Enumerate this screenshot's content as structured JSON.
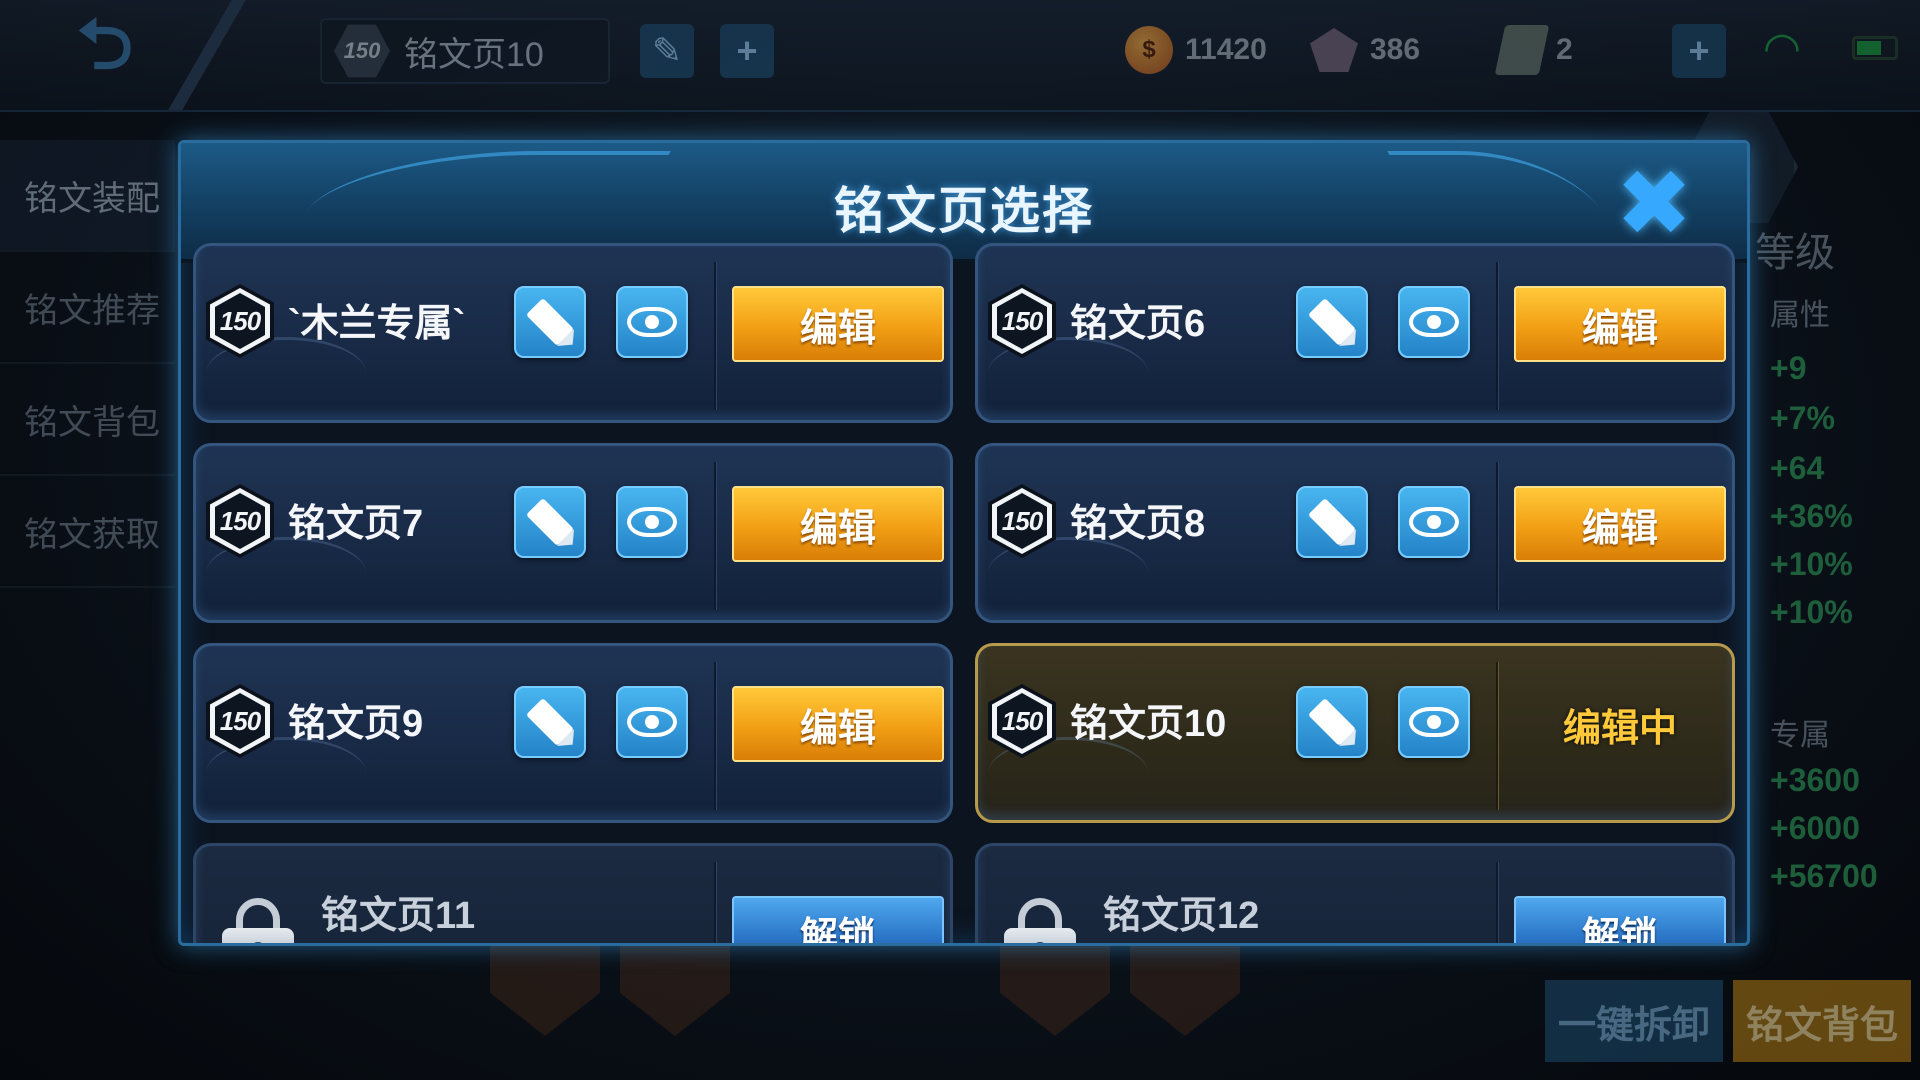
{
  "topbar": {
    "back_icon": "back-arrow-icon",
    "current_page_level": "150",
    "current_page_name": "铭文页10",
    "currency": {
      "gold": "11420",
      "diamonds": "386",
      "tickets": "2"
    }
  },
  "leftnav": {
    "items": [
      {
        "label": "铭文装配"
      },
      {
        "label": "铭文推荐"
      },
      {
        "label": "铭文背包"
      },
      {
        "label": "铭文获取"
      }
    ]
  },
  "right_panel": {
    "level_label": "等级",
    "attr_label": "属性",
    "stats": [
      "+9",
      "+7%",
      "+64",
      "+36%",
      "+10%",
      "+10%"
    ],
    "exclusive_label": "专属",
    "exclusive_stats": [
      "+3600",
      "+6000",
      "+56700"
    ]
  },
  "bottom_buttons": {
    "unload_all": "一键拆卸",
    "bag": "铭文背包"
  },
  "modal": {
    "title": "铭文页选择",
    "close_icon": "close-x-icon",
    "pages": [
      {
        "level": "150",
        "name": "`木兰专属`",
        "action": "编辑",
        "state": "available"
      },
      {
        "level": "150",
        "name": "铭文页6",
        "action": "编辑",
        "state": "available"
      },
      {
        "level": "150",
        "name": "铭文页7",
        "action": "编辑",
        "state": "available"
      },
      {
        "level": "150",
        "name": "铭文页8",
        "action": "编辑",
        "state": "available"
      },
      {
        "level": "150",
        "name": "铭文页9",
        "action": "编辑",
        "state": "available"
      },
      {
        "level": "150",
        "name": "铭文页10",
        "action": "编辑中",
        "state": "active"
      },
      {
        "level": "",
        "name": "铭文页11",
        "action": "解锁",
        "state": "locked"
      },
      {
        "level": "",
        "name": "铭文页12",
        "action": "解锁",
        "state": "locked"
      }
    ]
  },
  "colors": {
    "accent_blue": "#36a9ff",
    "edit_orange": "#f4a317",
    "active_gold": "#b89a4c",
    "stat_green": "#2fa05a"
  }
}
